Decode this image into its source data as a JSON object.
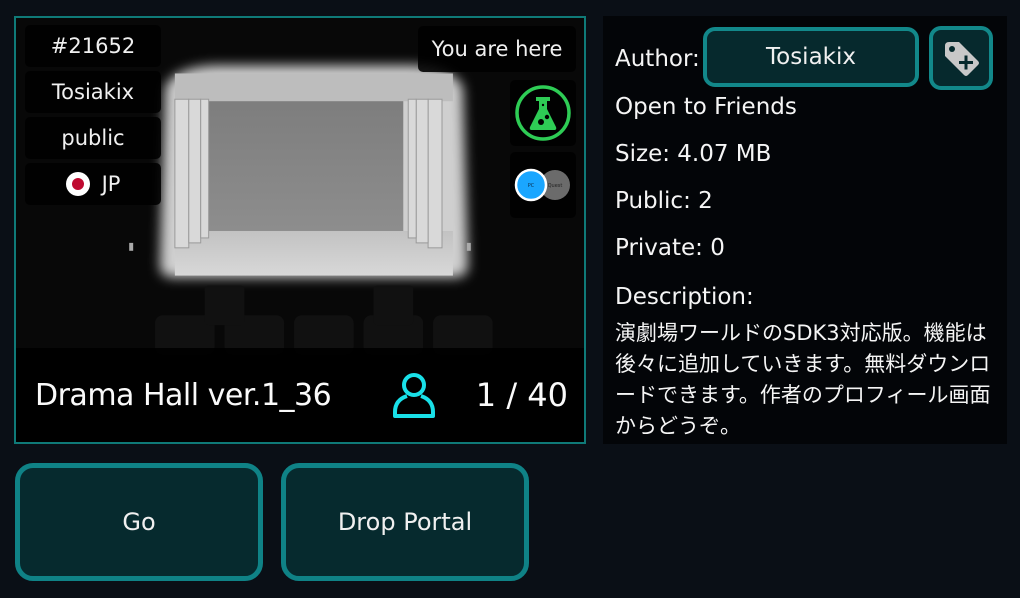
{
  "world_card": {
    "instance_id": "#21652",
    "owner": "Tosiakix",
    "access": "public",
    "region": {
      "code": "JP",
      "flag_icon": "japan-flag-icon"
    },
    "location_label": "You are here",
    "labs_badge_icon": "flask-icon",
    "platforms": [
      {
        "label": "PC",
        "color": "#1aa6ff",
        "active": true
      },
      {
        "label": "Quest",
        "color": "#6b6b6b",
        "active": false
      }
    ],
    "world_name": "Drama Hall ver.1_36",
    "occupancy": "1 / 40",
    "occupancy_icon": "user-icon"
  },
  "details": {
    "author_label": "Author:",
    "author_name": "Tosiakix",
    "add_tag_icon": "tag-plus-icon",
    "instance_type": "Open to Friends",
    "size": "Size: 4.07 MB",
    "public": "Public: 2",
    "private": "Private: 0",
    "description_label": "Description:",
    "description": "演劇場ワールドのSDK3対応版。機能は後々に追加していきます。無料ダウンロードできます。作者のプロフィール画面からどうぞ。"
  },
  "actions": {
    "go_label": "Go",
    "drop_portal_label": "Drop Portal"
  },
  "colors": {
    "accent": "#12888a",
    "button_bg": "#06292d",
    "labs_green": "#2ecc55",
    "occupancy_cyan": "#19e0e8",
    "background": "#0a0f16"
  }
}
